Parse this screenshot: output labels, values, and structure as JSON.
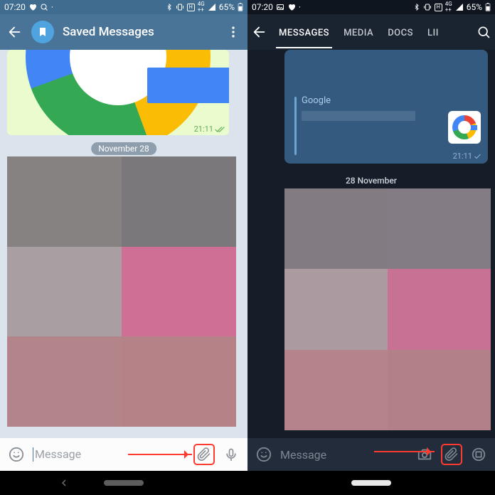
{
  "status": {
    "time": "07:20",
    "battery": "65%"
  },
  "left": {
    "header_title": "Saved Messages",
    "bubble_time": "21:11",
    "date": "November 28",
    "input_placeholder": "Message"
  },
  "right": {
    "tabs": {
      "t0": "MESSAGES",
      "t1": "MEDIA",
      "t2": "DOCS",
      "t3": "LII"
    },
    "link_label": "Google",
    "link_time": "21:11",
    "date": "28 November",
    "input_placeholder": "Message"
  },
  "icons": {
    "heart": "heart-icon",
    "q": "q-icon",
    "bt": "bluetooth-icon",
    "vib": "vibrate-icon",
    "batt": "battery-icon",
    "sig": "signal-icon",
    "back": "back-icon",
    "bookmark": "bookmark-icon",
    "dots": "more-vertical-icon",
    "search": "search-icon",
    "smile": "emoji-icon",
    "clip": "paperclip-icon",
    "mic": "microphone-icon",
    "camera": "camera-icon",
    "grid": "grid-icon",
    "checks": "double-check-icon",
    "check": "check-icon"
  }
}
